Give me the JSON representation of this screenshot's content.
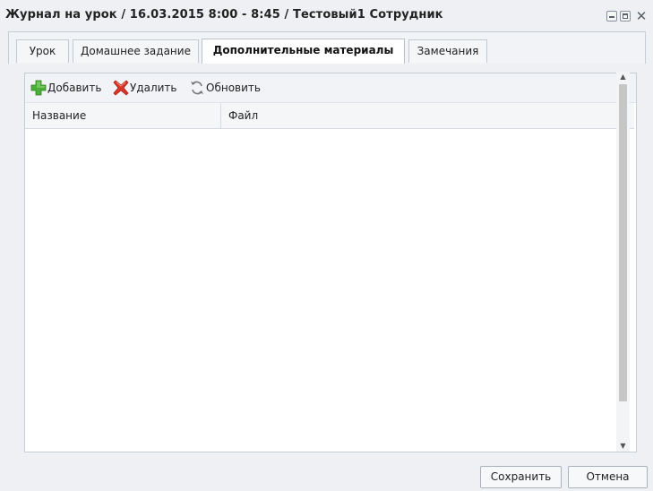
{
  "window": {
    "title": "Журнал на урок / 16.03.2015 8:00 - 8:45 / Тестовый1 Сотрудник",
    "controls": [
      "minimize-icon",
      "maximize-icon",
      "close-icon"
    ]
  },
  "tabs": [
    {
      "label": "Урок",
      "active": false
    },
    {
      "label": "Домашнее задание",
      "active": false
    },
    {
      "label": "Дополнительные материалы",
      "active": true
    },
    {
      "label": "Замечания",
      "active": false
    }
  ],
  "toolbar": {
    "add_label": "Добавить",
    "delete_label": "Удалить",
    "refresh_label": "Обновить",
    "icons": {
      "add": "plus-icon",
      "delete": "delete-cross-icon",
      "refresh": "refresh-icon"
    }
  },
  "grid": {
    "columns": [
      "Название",
      "Файл"
    ],
    "rows": []
  },
  "footer": {
    "save_label": "Сохранить",
    "cancel_label": "Отмена"
  },
  "colors": {
    "add_icon": "#4caf3a",
    "delete_icon": "#d8352a",
    "window_bg": "#eef0f3"
  }
}
